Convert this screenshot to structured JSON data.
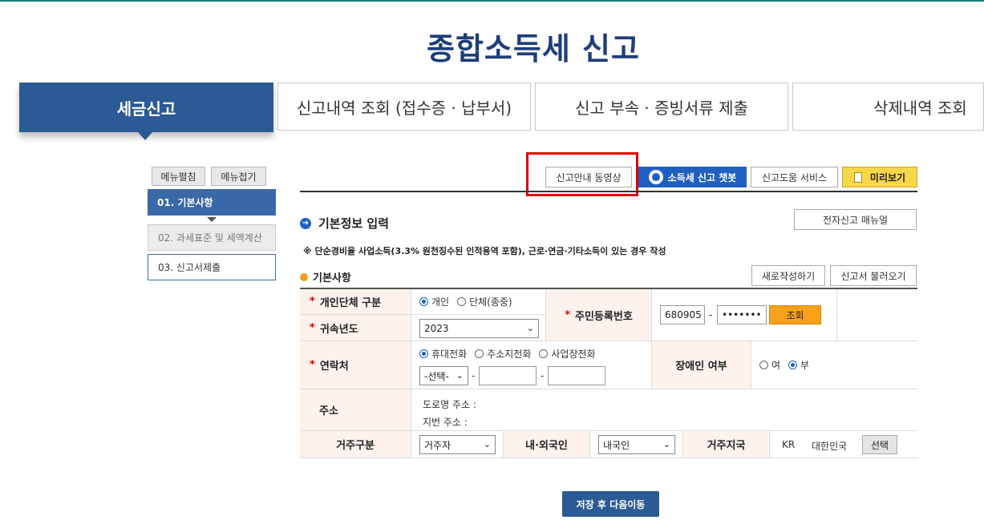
{
  "page": {
    "title": "종합소득세 신고"
  },
  "tabs": [
    {
      "label": "세금신고",
      "active": true
    },
    {
      "label": "신고내역 조회 (접수증 · 납부서)"
    },
    {
      "label": "신고 부속 · 증빙서류 제출"
    },
    {
      "label": "삭제내역 조회"
    }
  ],
  "sidebar": {
    "expand_label": "메뉴펼침",
    "collapse_label": "메뉴접기",
    "steps": [
      "01. 기본사항",
      "02. 과세표준 및 세액계산",
      "03. 신고서제출"
    ]
  },
  "toolbar": {
    "video_label": "신고안내 동영상",
    "chatbot_label": "소득세 신고 챗봇",
    "help_label": "신고도움 서비스",
    "preview_label": "미리보기"
  },
  "section": {
    "title": "기본정보 입력",
    "manual_label": "전자신고 매뉴얼",
    "note": "※ 단순경비율 사업소득(3.3% 원천징수된 인적용역 포함), 근로·연금·기타소득이 있는 경우 작성",
    "sub_title": "기본사항",
    "new_label": "새로작성하기",
    "load_label": "신고서 불러오기"
  },
  "form": {
    "entity_label": "개인단체 구분",
    "entity_options": [
      "개인",
      "단체(종중)"
    ],
    "year_label": "귀속년도",
    "year_value": "2023",
    "rrn_label": "주민등록번호",
    "rrn_front": "680905",
    "rrn_back": "•••••••",
    "lookup_label": "조회",
    "contact_label": "연락처",
    "contact_options": [
      "휴대전화",
      "주소지전화",
      "사업장전화"
    ],
    "phone_select": "-선택-",
    "dash": "-",
    "disability_label": "장애인 여부",
    "disability_options": [
      "여",
      "부"
    ],
    "address_label": "주소",
    "road_address_label": "도로명 주소 :",
    "lot_address_label": "지번 주소 :",
    "residence_label": "거주구분",
    "residence_value": "거주자",
    "nationality_label": "내·외국인",
    "nationality_value": "내국인",
    "country_label": "거주지국",
    "country_code": "KR",
    "country_name": "대한민국",
    "select_label": "선택"
  },
  "footer": {
    "save_label": "저장 후 다음이동"
  },
  "colors": {
    "primary": "#2b5a94",
    "accent": "#f9a11b",
    "label_bg": "#fdf3ec",
    "highlight": "#e00000"
  }
}
